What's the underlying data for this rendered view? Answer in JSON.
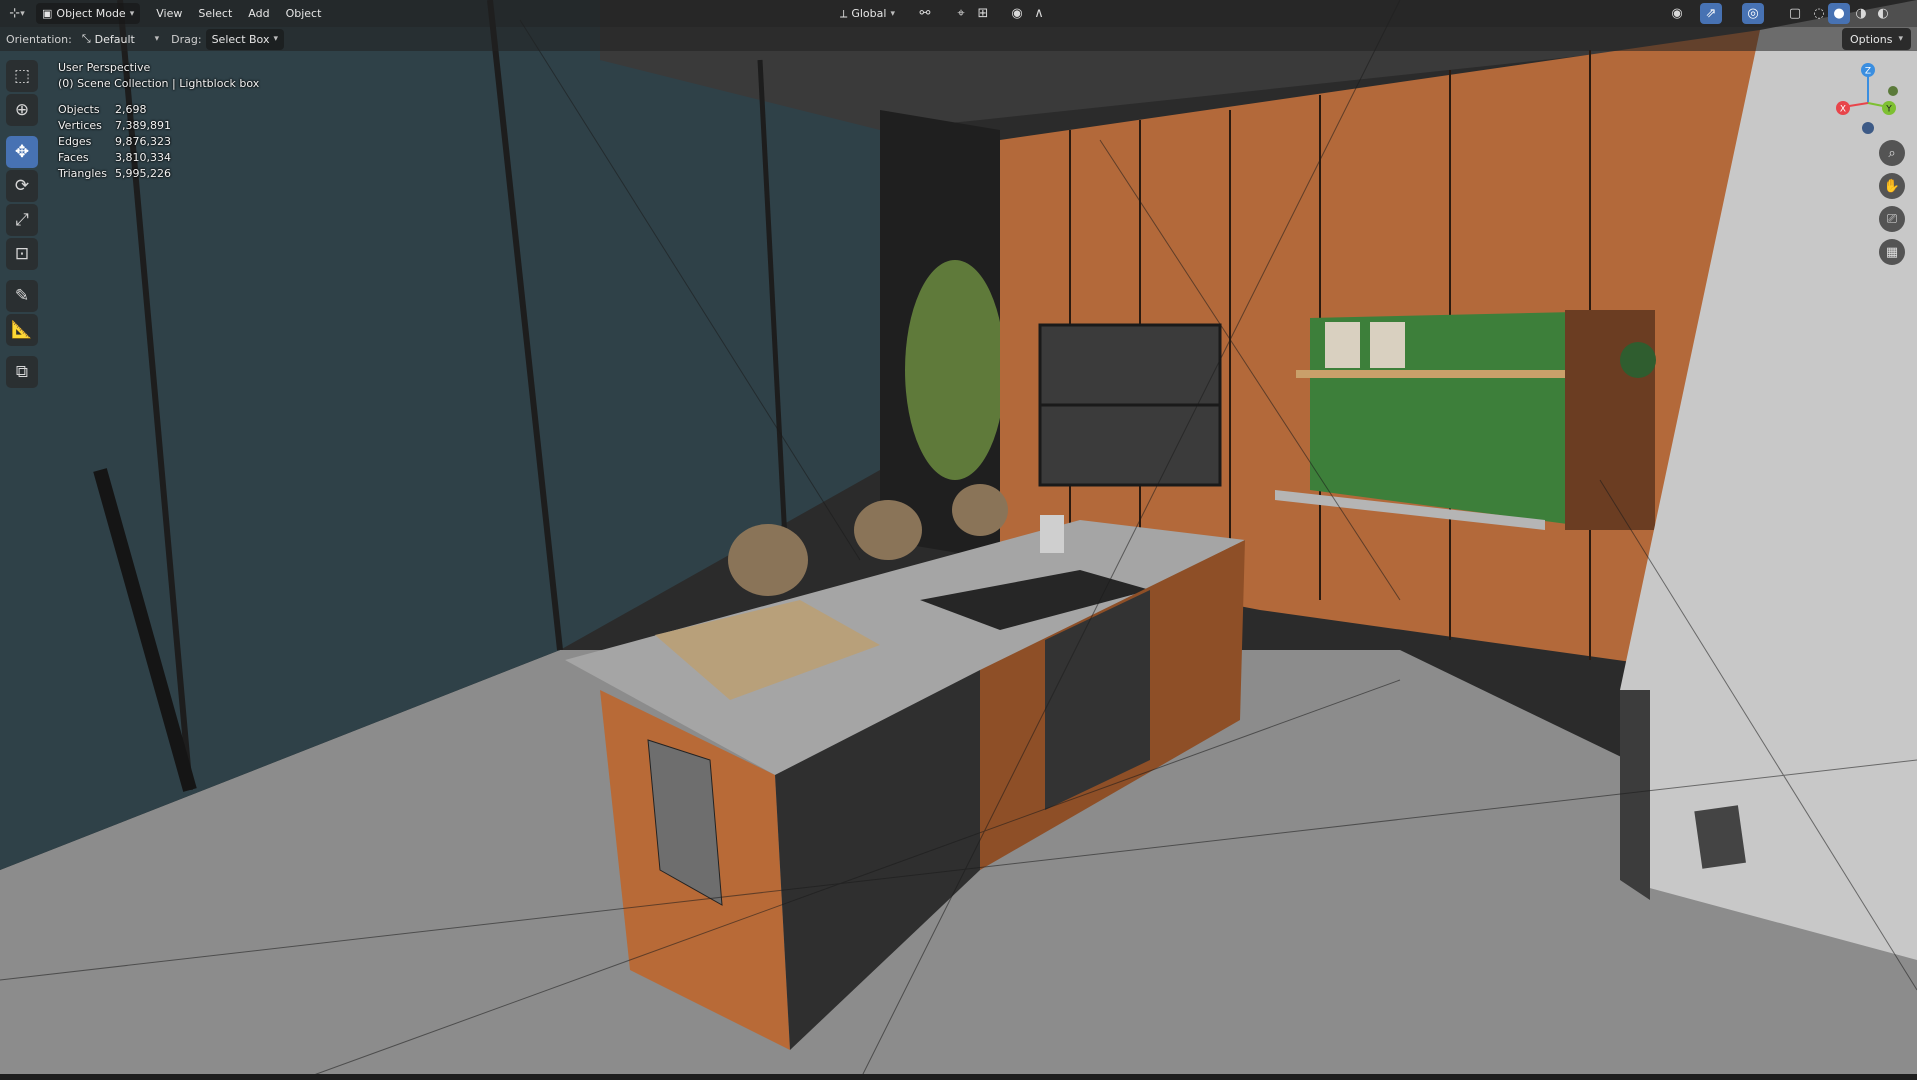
{
  "header": {
    "editor_icon": "viewport-editor-icon",
    "mode": "Object Mode",
    "menus": [
      "View",
      "Select",
      "Add",
      "Object"
    ],
    "transform_orientation": "Global"
  },
  "tool_settings": {
    "orientation_label": "Orientation:",
    "orientation_value": "Default",
    "drag_label": "Drag:",
    "drag_value": "Select Box",
    "options_label": "Options"
  },
  "overlay": {
    "view_name": "User Perspective",
    "collection": "(0) Scene Collection | Lightblock box",
    "stats": [
      {
        "label": "Objects",
        "value": "2,698"
      },
      {
        "label": "Vertices",
        "value": "7,389,891"
      },
      {
        "label": "Edges",
        "value": "9,876,323"
      },
      {
        "label": "Faces",
        "value": "3,810,334"
      },
      {
        "label": "Triangles",
        "value": "5,995,226"
      }
    ]
  },
  "tools": [
    "select-box-icon",
    "cursor-icon",
    "move-icon",
    "rotate-icon",
    "scale-icon",
    "transform-icon",
    "annotate-icon",
    "measure-icon",
    "add-cube-icon"
  ],
  "active_tool": "move-icon",
  "gizmo": {
    "x_label": "X",
    "y_label": "Y",
    "z_label": "Z"
  },
  "colors": {
    "accent": "#4772b3",
    "wood": "#b86a37",
    "counter": "#9a9a9a",
    "floor": "#8a8a8a",
    "glass": "#2e3f46",
    "green_panel": "#3d7f3a",
    "axis_x": "#e8454b",
    "axis_y": "#7ec032",
    "axis_z": "#3a8ee0"
  }
}
